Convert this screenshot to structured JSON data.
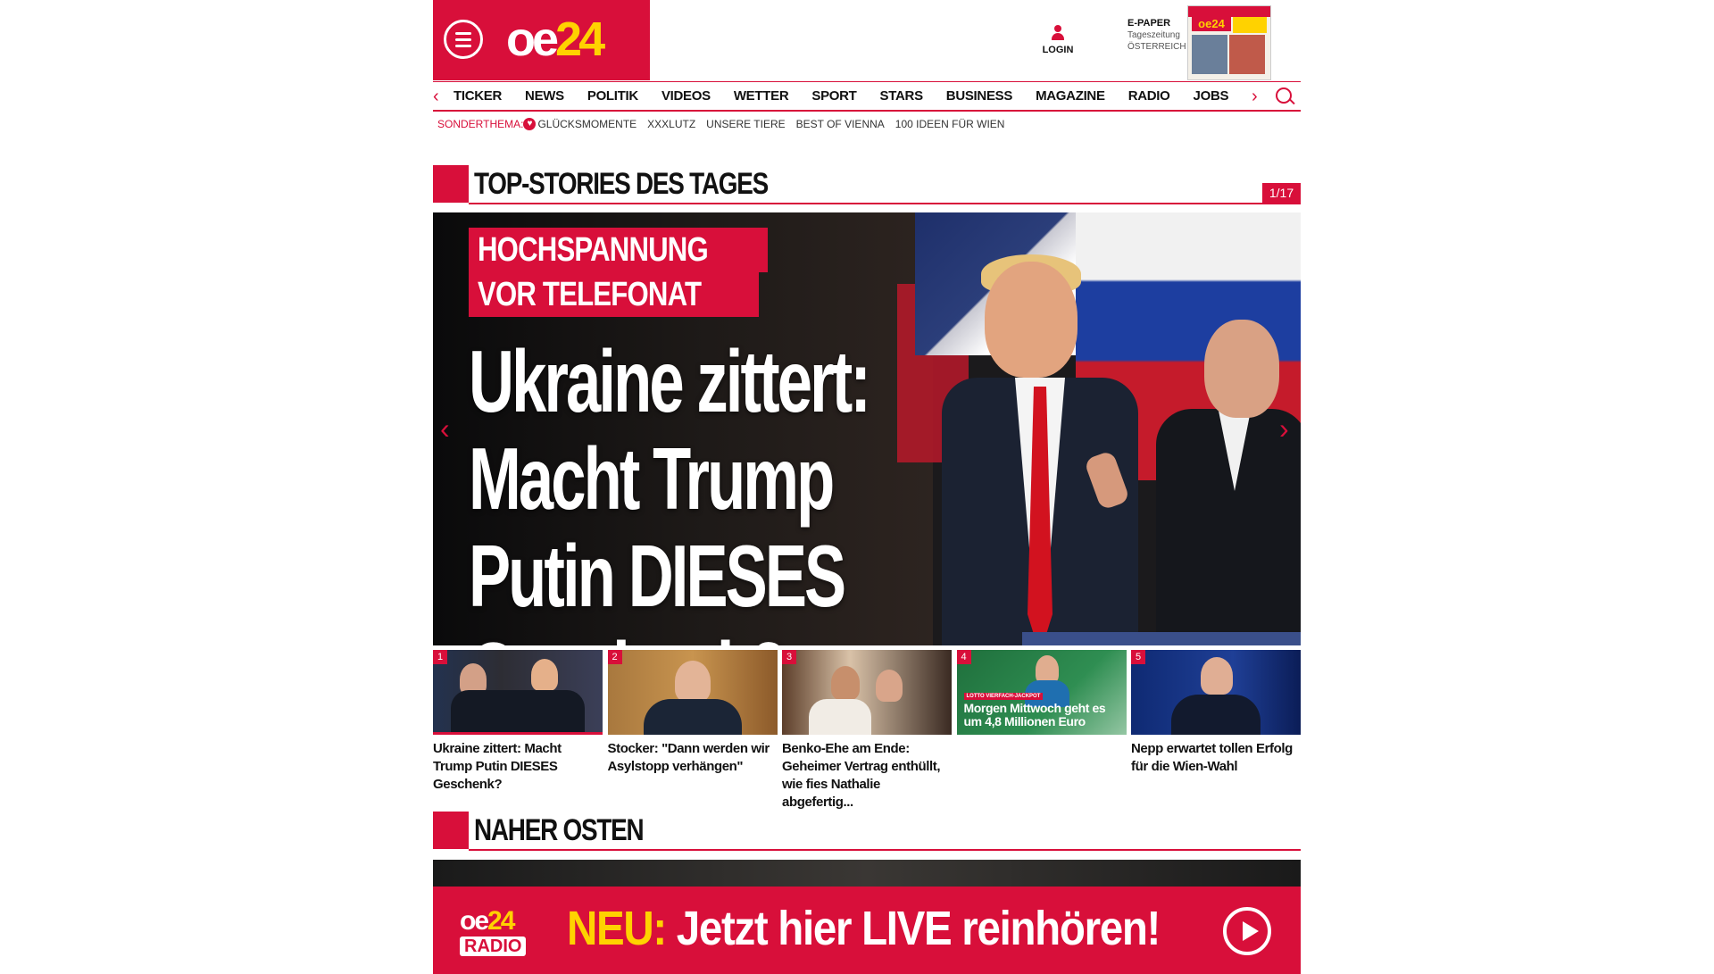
{
  "header": {
    "logo_oe": "oe",
    "logo_24": "24",
    "login_label": "LOGIN",
    "epaper": {
      "title": "E-PAPER",
      "sub1": "Tageszeitung",
      "sub2": "ÖSTERREICH"
    }
  },
  "nav": {
    "items": [
      "TICKER",
      "NEWS",
      "POLITIK",
      "VIDEOS",
      "WETTER",
      "SPORT",
      "STARS",
      "BUSINESS",
      "MAGAZINE",
      "RADIO",
      "JOBS"
    ]
  },
  "subnav": {
    "special_label": "SONDERTHEMA:",
    "items": [
      "GLÜCKSMOMENTE",
      "XXXLUTZ",
      "UNSERE TIERE",
      "BEST OF VIENNA",
      "100 IDEEN FÜR WIEN"
    ]
  },
  "top_stories": {
    "title": "TOP-STORIES DES TAGES",
    "counter": "1/17",
    "hero": {
      "kicker_line1": "HOCHSPANNUNG",
      "kicker_line2": "VOR TELEFONAT",
      "headline": "Ukraine zittert:\nMacht Trump\nPutin DIESES Geschenk?"
    },
    "teasers": [
      {
        "num": "1",
        "title": "Ukraine zittert: Macht Trump Putin DIESES Geschenk?"
      },
      {
        "num": "2",
        "title": "Stocker: \"Dann werden wir Asylstopp verhängen\""
      },
      {
        "num": "3",
        "title": "Benko-Ehe am Ende: Geheimer Vertrag enthüllt, wie fies Nathalie abgefertig..."
      },
      {
        "num": "4",
        "title": "",
        "promo_tag": "LOTTO VIERFACH-JACKPOT",
        "promo_text": "Morgen Mittwoch geht es um 4,8 Millionen Euro"
      },
      {
        "num": "5",
        "title": "Nepp erwartet tollen Erfolg für die Wien-Wahl"
      }
    ]
  },
  "section2": {
    "title": "NAHER OSTEN"
  },
  "radio_banner": {
    "logo_oe": "oe",
    "logo_24": "24",
    "logo_radio": "RADIO",
    "neu": "NEU:",
    "text": " Jetzt hier LIVE reinhören!"
  }
}
